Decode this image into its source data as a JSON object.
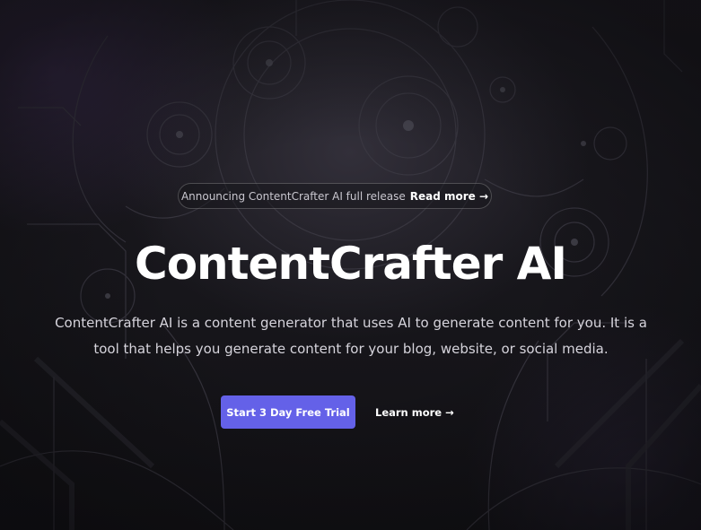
{
  "hero": {
    "announcement": {
      "text": "Announcing ContentCrafter AI full release",
      "link_label": "Read more →"
    },
    "title": "ContentCrafter AI",
    "subtitle": "ContentCrafter AI is a content generator that uses AI to generate content for you. It is a tool that helps you generate content for your blog, website, or social media.",
    "primary_cta": "Start 3 Day Free Trial",
    "secondary_cta": "Learn more →"
  },
  "theme": {
    "background": "#151418",
    "accent": "#6461e8",
    "text": "#ffffff",
    "muted_text": "#d6d4dc"
  }
}
